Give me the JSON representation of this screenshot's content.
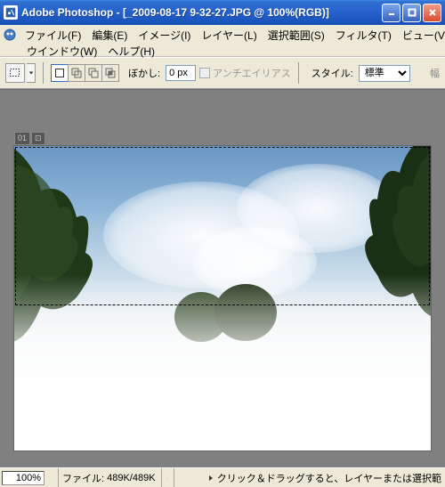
{
  "titlebar": {
    "app": "Adobe Photoshop",
    "doc": "[_2009-08-17 9-32-27.JPG @ 100%(RGB)]"
  },
  "menu": {
    "row1": [
      "ファイル(F)",
      "編集(E)",
      "イメージ(I)",
      "レイヤー(L)",
      "選択範囲(S)",
      "フィルタ(T)",
      "ビュー(V)"
    ],
    "row2": [
      "ウインドウ(W)",
      "ヘルプ(H)"
    ]
  },
  "options": {
    "feather_label": "ぼかし:",
    "feather_value": "0 px",
    "antialias": "アンチエイリアス",
    "style_label": "スタイル:",
    "style_value": "標準",
    "width_label": "幅"
  },
  "canvas": {
    "tag1": "01",
    "tag2": "⊡"
  },
  "status": {
    "zoom": "100%",
    "file_label": "ファイル:",
    "file_value": "489K/489K",
    "hint": "クリック＆ドラッグすると、レイヤーまたは選択範"
  }
}
